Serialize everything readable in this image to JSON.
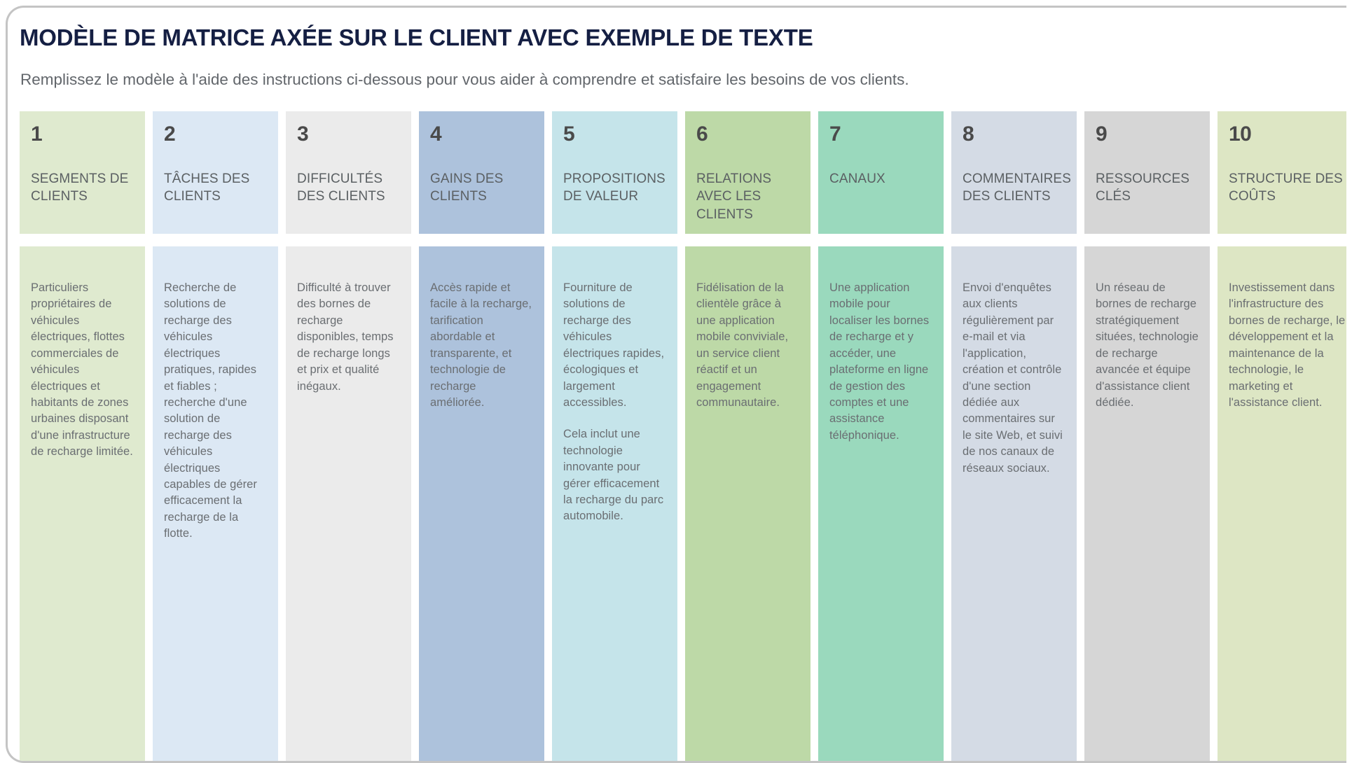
{
  "header": {
    "title": "MODÈLE DE MATRICE AXÉE SUR LE CLIENT AVEC EXEMPLE DE TEXTE",
    "subtitle": "Remplissez le modèle à l'aide des instructions ci-dessous pour vous aider à comprendre et satisfaire les besoins de vos clients."
  },
  "colors": {
    "title": "#151f43",
    "subtitle": "#62666b",
    "number": "#4a4a4a",
    "label": "#5b6063",
    "body_text": "#6a6e72",
    "card_border": "#c4c4c4",
    "page_background": "#ffffff",
    "column_fills": [
      "#dfeacf",
      "#dce8f4",
      "#ebebeb",
      "#adc2dc",
      "#c5e4ea",
      "#bdd9a7",
      "#9ad9bd",
      "#d4dbe5",
      "#d6d6d6",
      "#dde6c4"
    ]
  },
  "columns": [
    {
      "number": "1",
      "label": "SEGMENTS DE CLIENTS",
      "fill": "#dfeacf",
      "paragraphs": [
        "Particuliers propriétaires de véhicules électriques, flottes commerciales de véhicules électriques et habitants de zones urbaines disposant d'une infrastructure de recharge limitée."
      ]
    },
    {
      "number": "2",
      "label": "TÂCHES DES CLIENTS",
      "fill": "#dce8f4",
      "paragraphs": [
        "Recherche de solutions de recharge des véhicules électriques pratiques, rapides et fiables ; recherche d'une solution de recharge des véhicules électriques capables de gérer efficacement la recharge de la flotte."
      ]
    },
    {
      "number": "3",
      "label": "DIFFICULTÉS DES CLIENTS",
      "fill": "#ebebeb",
      "paragraphs": [
        "Difficulté à trouver des bornes de recharge disponibles, temps de recharge longs et prix et qualité inégaux."
      ]
    },
    {
      "number": "4",
      "label": "GAINS DES CLIENTS",
      "fill": "#adc2dc",
      "paragraphs": [
        "Accès rapide et facile à la recharge, tarification abordable et transparente, et technologie de recharge améliorée."
      ]
    },
    {
      "number": "5",
      "label": "PROPOSITIONS DE VALEUR",
      "fill": "#c5e4ea",
      "paragraphs": [
        "Fourniture de solutions de recharge des véhicules électriques rapides, écologiques et largement accessibles.",
        "Cela inclut une technologie innovante pour gérer efficacement la recharge du parc automobile."
      ]
    },
    {
      "number": "6",
      "label": "RELATIONS AVEC LES CLIENTS",
      "fill": "#bdd9a7",
      "paragraphs": [
        "Fidélisation de la clientèle grâce à une application mobile conviviale, un service client réactif et un engagement communautaire."
      ]
    },
    {
      "number": "7",
      "label": "CANAUX",
      "fill": "#9ad9bd",
      "paragraphs": [
        "Une application mobile pour localiser les bornes de recharge et y accéder, une plateforme en ligne de gestion des comptes et une assistance téléphonique."
      ]
    },
    {
      "number": "8",
      "label": "COMMENTAIRES DES CLIENTS",
      "fill": "#d4dbe5",
      "paragraphs": [
        "Envoi d'enquêtes aux clients régulièrement par e-mail et via l'application, création et contrôle d'une section dédiée aux commentaires sur le site Web, et suivi de nos canaux de réseaux sociaux."
      ]
    },
    {
      "number": "9",
      "label": "RESSOURCES CLÉS",
      "fill": "#d6d6d6",
      "paragraphs": [
        "Un réseau de bornes de recharge stratégiquement situées, technologie de recharge avancée et équipe d'assistance client dédiée."
      ]
    },
    {
      "number": "10",
      "label": "STRUCTURE DES COÛTS",
      "fill": "#dde6c4",
      "paragraphs": [
        "Investissement dans l'infrastructure des bornes de recharge, le développement et la maintenance de la technologie, le marketing et l'assistance client."
      ]
    }
  ]
}
